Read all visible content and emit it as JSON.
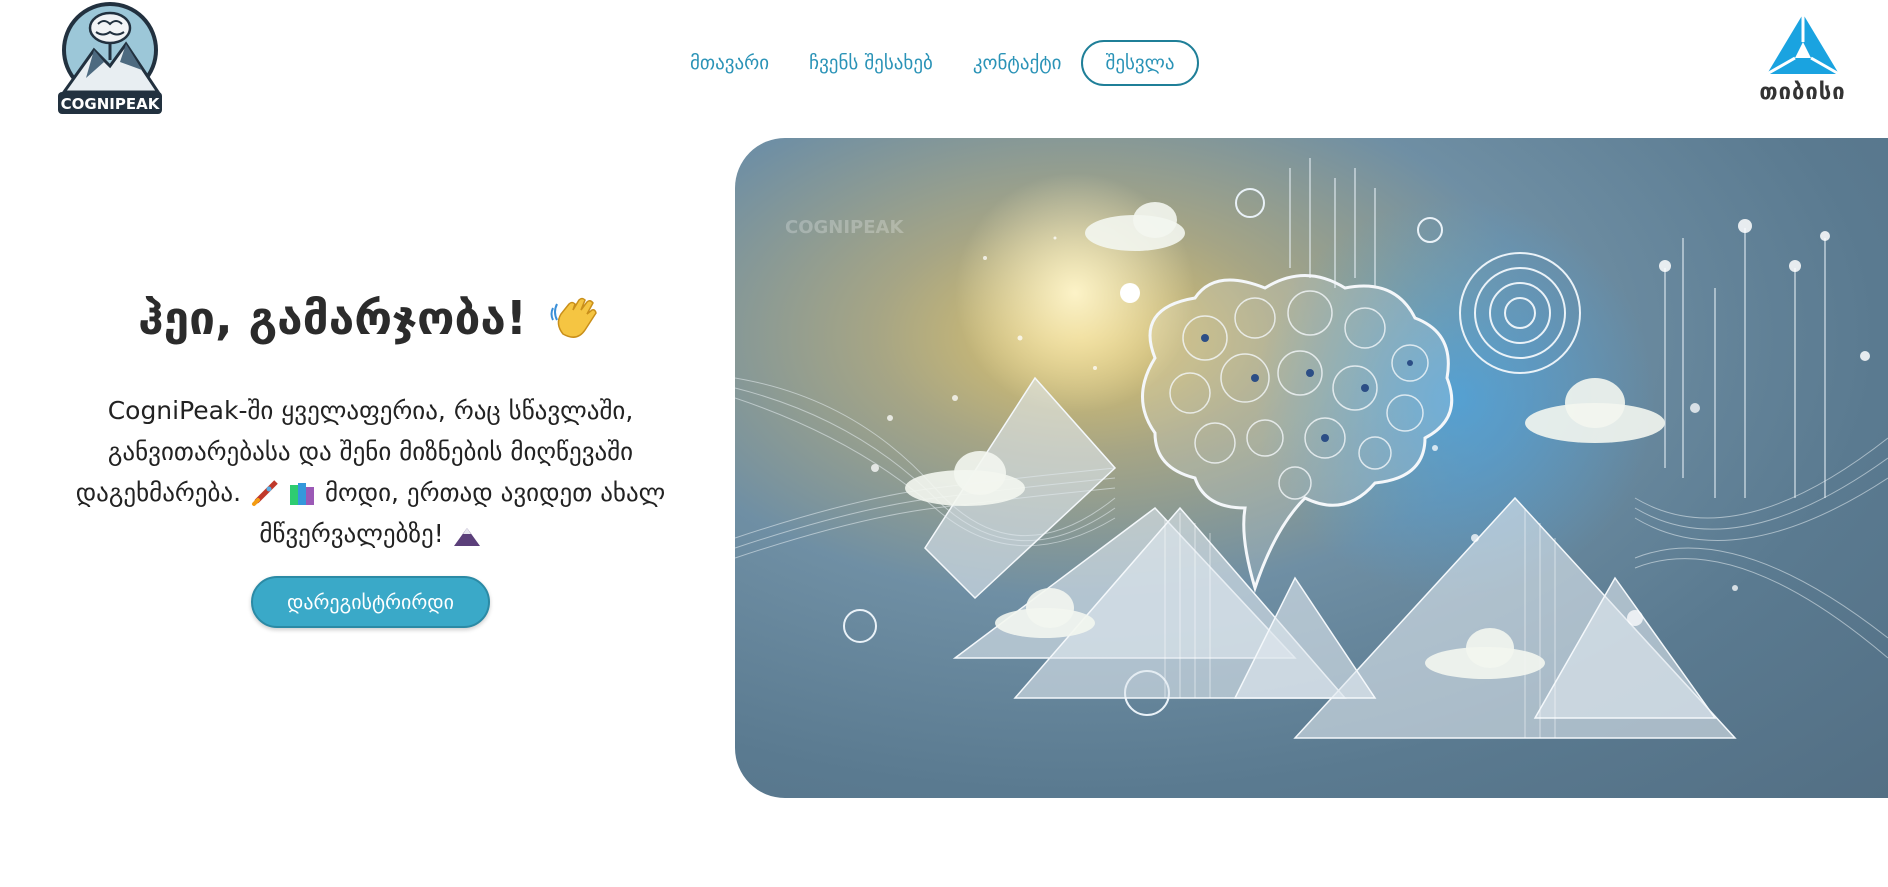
{
  "header": {
    "brand_left": "COGNIPEAK",
    "brand_right": "თიბისი",
    "nav": {
      "home": "მთავარი",
      "about": "ჩვენს შესახებ",
      "contact": "კონტაქტი",
      "login": "შესვლა"
    }
  },
  "hero": {
    "title": "ჰეი, გამარჯობა!",
    "text_part1": "CogniPeak-ში ყველაფერია, რაც სწავლაში, განვითარებასა და შენი მიზნების მიღწევაში დაგეხმარება.",
    "text_part2": "მოდი, ერთად ავიდეთ ახალ მწვერვალებზე!",
    "cta": "დარეგისტრირდი",
    "image_watermark": "COGNIPEAK"
  },
  "icons": {
    "title": "waving-hand-icon",
    "text": [
      "rocket-icon",
      "books-icon",
      "mountain-icon"
    ]
  },
  "colors": {
    "accent": "#2a93b7",
    "button": "#3aa9c8",
    "brand_right": "#1aa3e0"
  }
}
